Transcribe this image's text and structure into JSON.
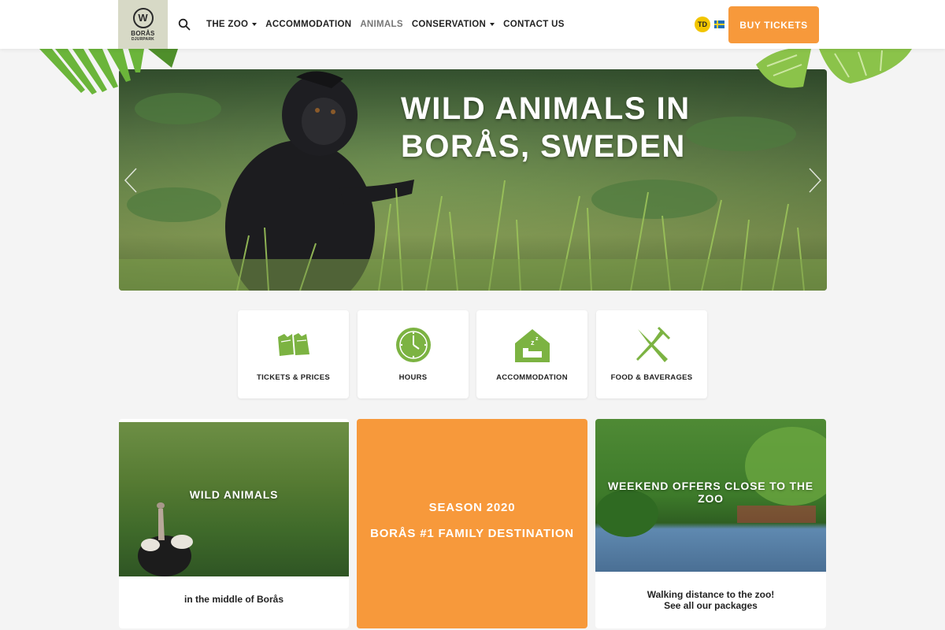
{
  "header": {
    "logo": {
      "mark": "W",
      "name": "BORÅS",
      "sub": "DJURPARK"
    },
    "nav": [
      {
        "label": "THE ZOO",
        "dropdown": true
      },
      {
        "label": "ACCOMMODATION",
        "dropdown": false
      },
      {
        "label": "ANIMALS",
        "dropdown": false,
        "active": true
      },
      {
        "label": "CONSERVATION",
        "dropdown": true
      },
      {
        "label": "CONTACT US",
        "dropdown": false
      }
    ],
    "badge": "TD",
    "buy_label": "BUY TICKETS",
    "accent": "#f7993b"
  },
  "hero": {
    "title_line1": "WILD ANIMALS IN",
    "title_line2": "BORÅS, SWEDEN"
  },
  "quick_links": [
    {
      "label": "TICKETS & PRICES",
      "icon": "tickets-icon"
    },
    {
      "label": "HOURS",
      "icon": "clock-icon"
    },
    {
      "label": "ACCOMMODATION",
      "icon": "house-sleep-icon"
    },
    {
      "label": "FOOD & BAVERAGES",
      "icon": "fork-knife-icon"
    }
  ],
  "cards": {
    "wild": {
      "title": "WILD ANIMALS",
      "caption": "in the middle of Borås"
    },
    "season": {
      "line1": "SEASON 2020",
      "line2": "BORÅS #1 FAMILY DESTINATION"
    },
    "weekend": {
      "title": "WEEKEND OFFERS CLOSE TO THE ZOO",
      "caption1": "Walking distance to the zoo!",
      "caption2": "See all our packages"
    }
  },
  "colors": {
    "green_icon": "#7cb342",
    "orange": "#f7993b",
    "logo_bg": "#d7d9c6"
  }
}
